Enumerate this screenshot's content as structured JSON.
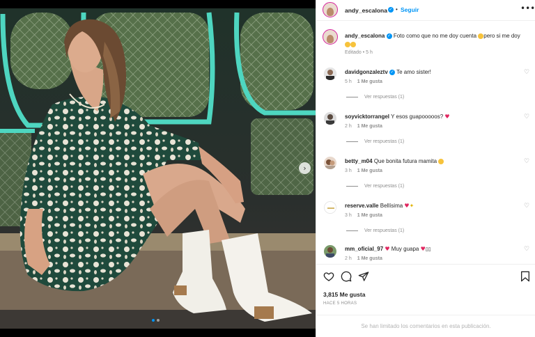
{
  "header": {
    "username": "andy_escalona",
    "separator": "•",
    "follow_label": "Seguir",
    "more_icon": "more-horizontal-icon",
    "more_glyph": "•••"
  },
  "caption": {
    "username": "andy_escalona",
    "text": "Foto como que no me doy cuenta",
    "text_mid": "pero si me doy",
    "edited_label": "Editado",
    "time": "5 h"
  },
  "comments": [
    {
      "username": "davidgonzaleztv",
      "text": "Te amo sister!",
      "time": "5 h",
      "likes": "1 Me gusta",
      "replies": "Ver respuestas (1)"
    },
    {
      "username": "soyvicktorrangel",
      "text": "Y esos guapooooos?",
      "time": "2 h",
      "likes": "1 Me gusta",
      "replies": "Ver respuestas (1)"
    },
    {
      "username": "betty_m04",
      "text": "Que bonita futura mamita",
      "time": "3 h",
      "likes": "1 Me gusta",
      "replies": "Ver respuestas (1)"
    },
    {
      "username": "reserve.valle",
      "text": "Bellísima",
      "time": "3 h",
      "likes": "1 Me gusta",
      "replies": "Ver respuestas (1)"
    },
    {
      "username": "mm_oficial_97",
      "text": "Muy guapa",
      "time": "2 h",
      "likes": "1 Me gusta",
      "replies": ""
    }
  ],
  "actions": {
    "like_icon": "heart-outline-icon",
    "comment_icon": "comment-icon",
    "share_icon": "send-icon",
    "save_icon": "bookmark-icon"
  },
  "likes_count": "3,815 Me gusta",
  "time_ago": "HACE 5 HORAS",
  "comments_limited": "Se han limitado los comentarios en esta publicación.",
  "carousel": {
    "next_glyph": "›",
    "current_slide": 1,
    "total_slides": 2
  },
  "colors": {
    "accent": "#0095f6",
    "heart": "#e0245e",
    "teal_frame": "#4ed6c0"
  }
}
